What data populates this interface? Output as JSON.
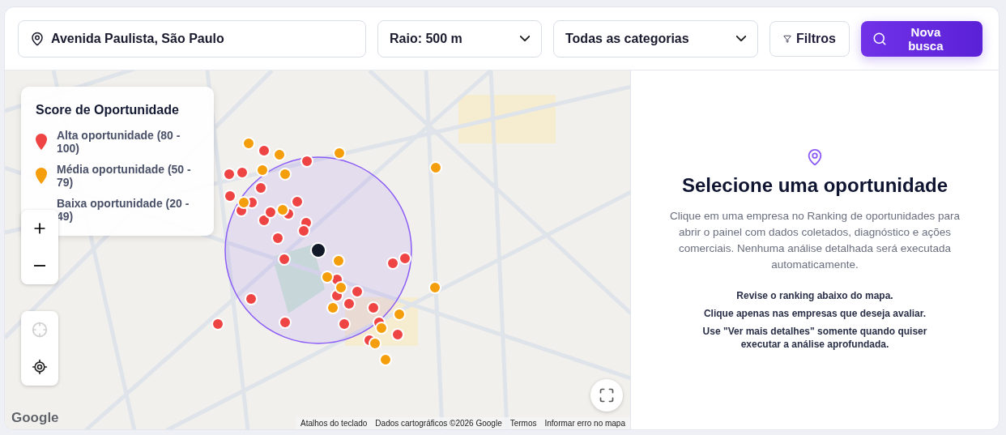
{
  "search": {
    "location": "Avenida Paulista, São Paulo",
    "radius": "Raio: 500 m",
    "category": "Todas as categorias",
    "filters": "Filtros",
    "submit": "Nova busca"
  },
  "map": {
    "legend": {
      "title": "Score de Oportunidade",
      "items": [
        {
          "label": "Alta oportunidade (80 - 100)",
          "color": "#ef4444"
        },
        {
          "label": "Média oportunidade (50 - 79)",
          "color": "#f59e0b"
        },
        {
          "label": "Baixa oportunidade (20 - 49)"
        }
      ]
    },
    "locate_buttons": [
      {
        "disabled": true
      },
      {
        "disabled": false
      }
    ],
    "logo": "Google",
    "attribution": [
      "Atalhos do teclado",
      "Dados cartográficos ©2026 Google",
      "Termos",
      "Informar erro no mapa"
    ]
  },
  "panel": {
    "title": "Selecione uma oportunidade",
    "description": "Clique em uma empresa no Ranking de oportunidades para abrir o painel com dados coletados, diagnóstico e ações comerciais. Nenhuma análise detalhada será executada automaticamente.",
    "tips": [
      "Revise o ranking abaixo do mapa.",
      "Clique apenas nas empresas que deseja avaliar.",
      "Use \"Ver mais detalhes\" somente quando quiser executar a análise aprofundada."
    ]
  }
}
